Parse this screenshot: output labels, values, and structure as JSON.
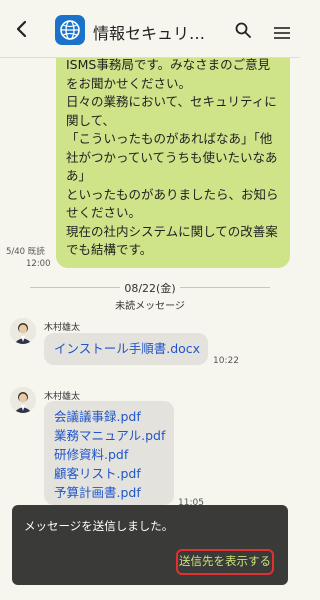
{
  "header": {
    "title": "情報セキュリ…",
    "back_icon": "chevron-left-icon",
    "app_icon": "globe-app-icon",
    "search_icon": "search-icon",
    "menu_icon": "hamburger-menu-icon"
  },
  "messages": {
    "own": {
      "lines": [
        "ISMS事務局です。みなさまのご意見",
        "をお聞かせください。",
        "日々の業務において、セキュリティに",
        "関して、",
        "「こういったものがあればなあ」「他",
        "社がつかっていてうちも使いたいなあ",
        "あ」",
        "といったものがありましたら、お知ら",
        "せください。",
        "現在の社内システムに関しての改善案",
        "でも結構です。"
      ],
      "read_status": "5/40 既読",
      "time": "12:00"
    },
    "date_separator": "08/22(金)",
    "unread_separator": "未読メッセージ",
    "incoming": [
      {
        "sender": "木村雄太",
        "files": [
          "インストール手順書.docx"
        ],
        "time": "10:22"
      },
      {
        "sender": "木村雄太",
        "files": [
          "会議議事録.pdf",
          "業務マニュアル.pdf",
          "研修資料.pdf",
          "顧客リスト.pdf",
          "予算計画書.pdf"
        ],
        "time": "11:05"
      }
    ]
  },
  "toast": {
    "message": "メッセージを送信しました。",
    "action_label": "送信先を表示する"
  },
  "colors": {
    "own_bubble": "#cfe389",
    "incoming_bubble": "#e3e2dc",
    "link": "#2156c8",
    "toast_bg": "#3a3a38",
    "highlight": "#e03030"
  }
}
